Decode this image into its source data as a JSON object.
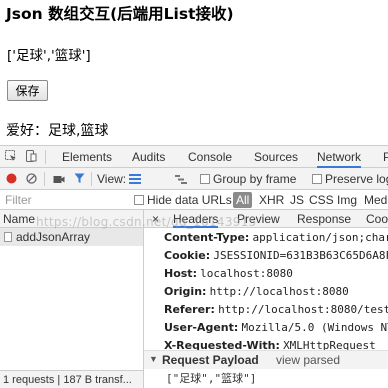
{
  "page": {
    "title": "Json 数组交互(后端用List接收)",
    "array_text": "['足球','篮球']",
    "save_label": "保存",
    "hobby_text": "爱好：足球,篮球"
  },
  "devtools": {
    "tabs": [
      "Elements",
      "Audits",
      "Console",
      "Sources",
      "Network",
      "P"
    ],
    "active_tab": "Network",
    "toolbar": {
      "view_label": "View:",
      "group_by_frame": "Group by frame",
      "preserve_log": "Preserve log"
    },
    "filter": {
      "placeholder": "Filter",
      "hide_data_urls": "Hide data URLs",
      "types": [
        "All",
        "XHR",
        "JS",
        "CSS",
        "Img",
        "Med"
      ]
    },
    "requests_column": "Name",
    "requests": [
      "addJsonArray"
    ],
    "status_bar": "1 requests | 187 B transf...",
    "detail_tabs": [
      "×",
      "Headers",
      "Preview",
      "Response",
      "Coo"
    ],
    "headers": [
      {
        "name": "Content-Type:",
        "value": "application/json;char"
      },
      {
        "name": "Cookie:",
        "value": "JSESSIONID=631B3B63C65D6A8F"
      },
      {
        "name": "Host:",
        "value": "localhost:8080"
      },
      {
        "name": "Origin:",
        "value": "http://localhost:8080"
      },
      {
        "name": "Referer:",
        "value": "http://localhost:8080/test"
      },
      {
        "name": "User-Agent:",
        "value": "Mozilla/5.0 (Windows NT"
      },
      {
        "name": "X-Requested-With:",
        "value": "XMLHttpRequest"
      }
    ],
    "payload": {
      "title": "Request Payload",
      "view_parsed": "view parsed",
      "value": "[\"足球\",\"篮球\"]"
    }
  },
  "watermark": "https://blog.csdn.net/qq_16143915",
  "colors": {
    "record": "#d93025",
    "filter_active": "#3879d9",
    "tab_underline": "#3879d9"
  }
}
